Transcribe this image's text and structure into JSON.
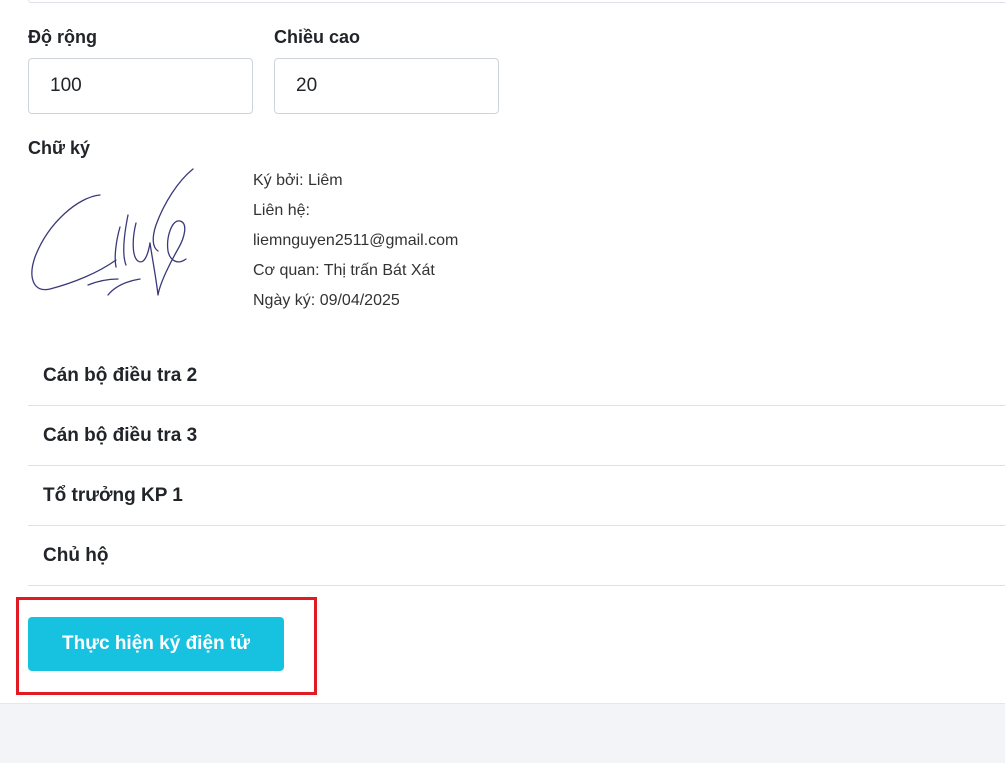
{
  "size_fields": {
    "width_label": "Độ rộng",
    "width_value": "100",
    "height_label": "Chiều cao",
    "height_value": "20"
  },
  "signature": {
    "label": "Chữ ký",
    "signed_by": "Ký bởi: Liêm",
    "contact_label": "Liên hệ:",
    "contact_email": "liemnguyen2511@gmail.com",
    "organization": "Cơ quan: Thị trấn Bát Xát",
    "date": "Ngày ký: 09/04/2025",
    "ink_color": "#3a3a7a"
  },
  "sections": [
    {
      "label": "Cán bộ điều tra 2"
    },
    {
      "label": "Cán bộ điều tra 3"
    },
    {
      "label": "Tổ trưởng KP 1"
    },
    {
      "label": "Chủ hộ"
    }
  ],
  "actions": {
    "sign_button_label": "Thực hiện ký điện tử",
    "button_color": "#17c1e0",
    "highlight_color": "#e21a23"
  }
}
